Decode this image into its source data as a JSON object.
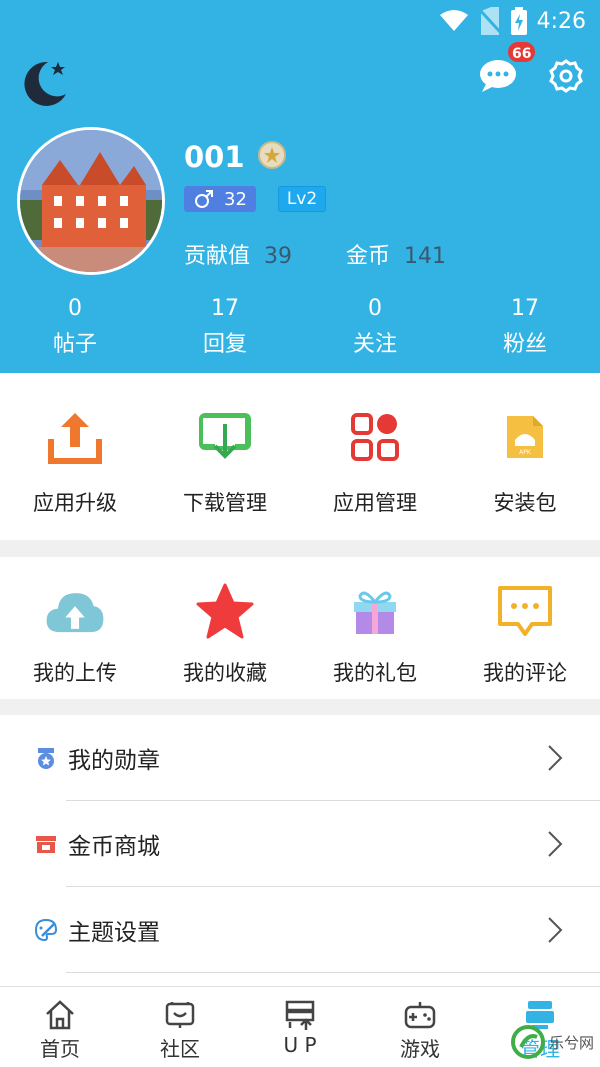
{
  "status_bar": {
    "time": "4:26"
  },
  "header": {
    "notification_count": "66",
    "username": "001",
    "gender_age": "32",
    "level": "Lv2",
    "contribution_label": "贡献值",
    "contribution_value": "39",
    "coins_label": "金币",
    "coins_value": "141",
    "counts": [
      {
        "value": "0",
        "label": "帖子"
      },
      {
        "value": "17",
        "label": "回复"
      },
      {
        "value": "0",
        "label": "关注"
      },
      {
        "value": "17",
        "label": "粉丝"
      }
    ]
  },
  "tools": [
    {
      "label": "应用升级",
      "icon": "upload-icon"
    },
    {
      "label": "下载管理",
      "icon": "download-icon"
    },
    {
      "label": "应用管理",
      "icon": "apps-icon"
    },
    {
      "label": "安装包",
      "icon": "apk-icon"
    }
  ],
  "personal": [
    {
      "label": "我的上传",
      "icon": "cloud-upload-icon"
    },
    {
      "label": "我的收藏",
      "icon": "star-icon"
    },
    {
      "label": "我的礼包",
      "icon": "gift-icon"
    },
    {
      "label": "我的评论",
      "icon": "comment-icon"
    }
  ],
  "menu": [
    {
      "label": "我的勋章",
      "icon": "medal-icon"
    },
    {
      "label": "金币商城",
      "icon": "shop-icon"
    },
    {
      "label": "主题设置",
      "icon": "palette-icon"
    }
  ],
  "tabs": [
    {
      "label": "首页",
      "icon": "home-icon"
    },
    {
      "label": "社区",
      "icon": "community-icon"
    },
    {
      "label": "U P",
      "icon": "up-icon"
    },
    {
      "label": "游戏",
      "icon": "gamepad-icon"
    },
    {
      "label": "管理",
      "icon": "manage-icon"
    }
  ],
  "watermark": {
    "text": "乐兮网"
  },
  "colors": {
    "header": "#33b3e4",
    "badge": "#e53935",
    "accent": "#33b3e4"
  }
}
